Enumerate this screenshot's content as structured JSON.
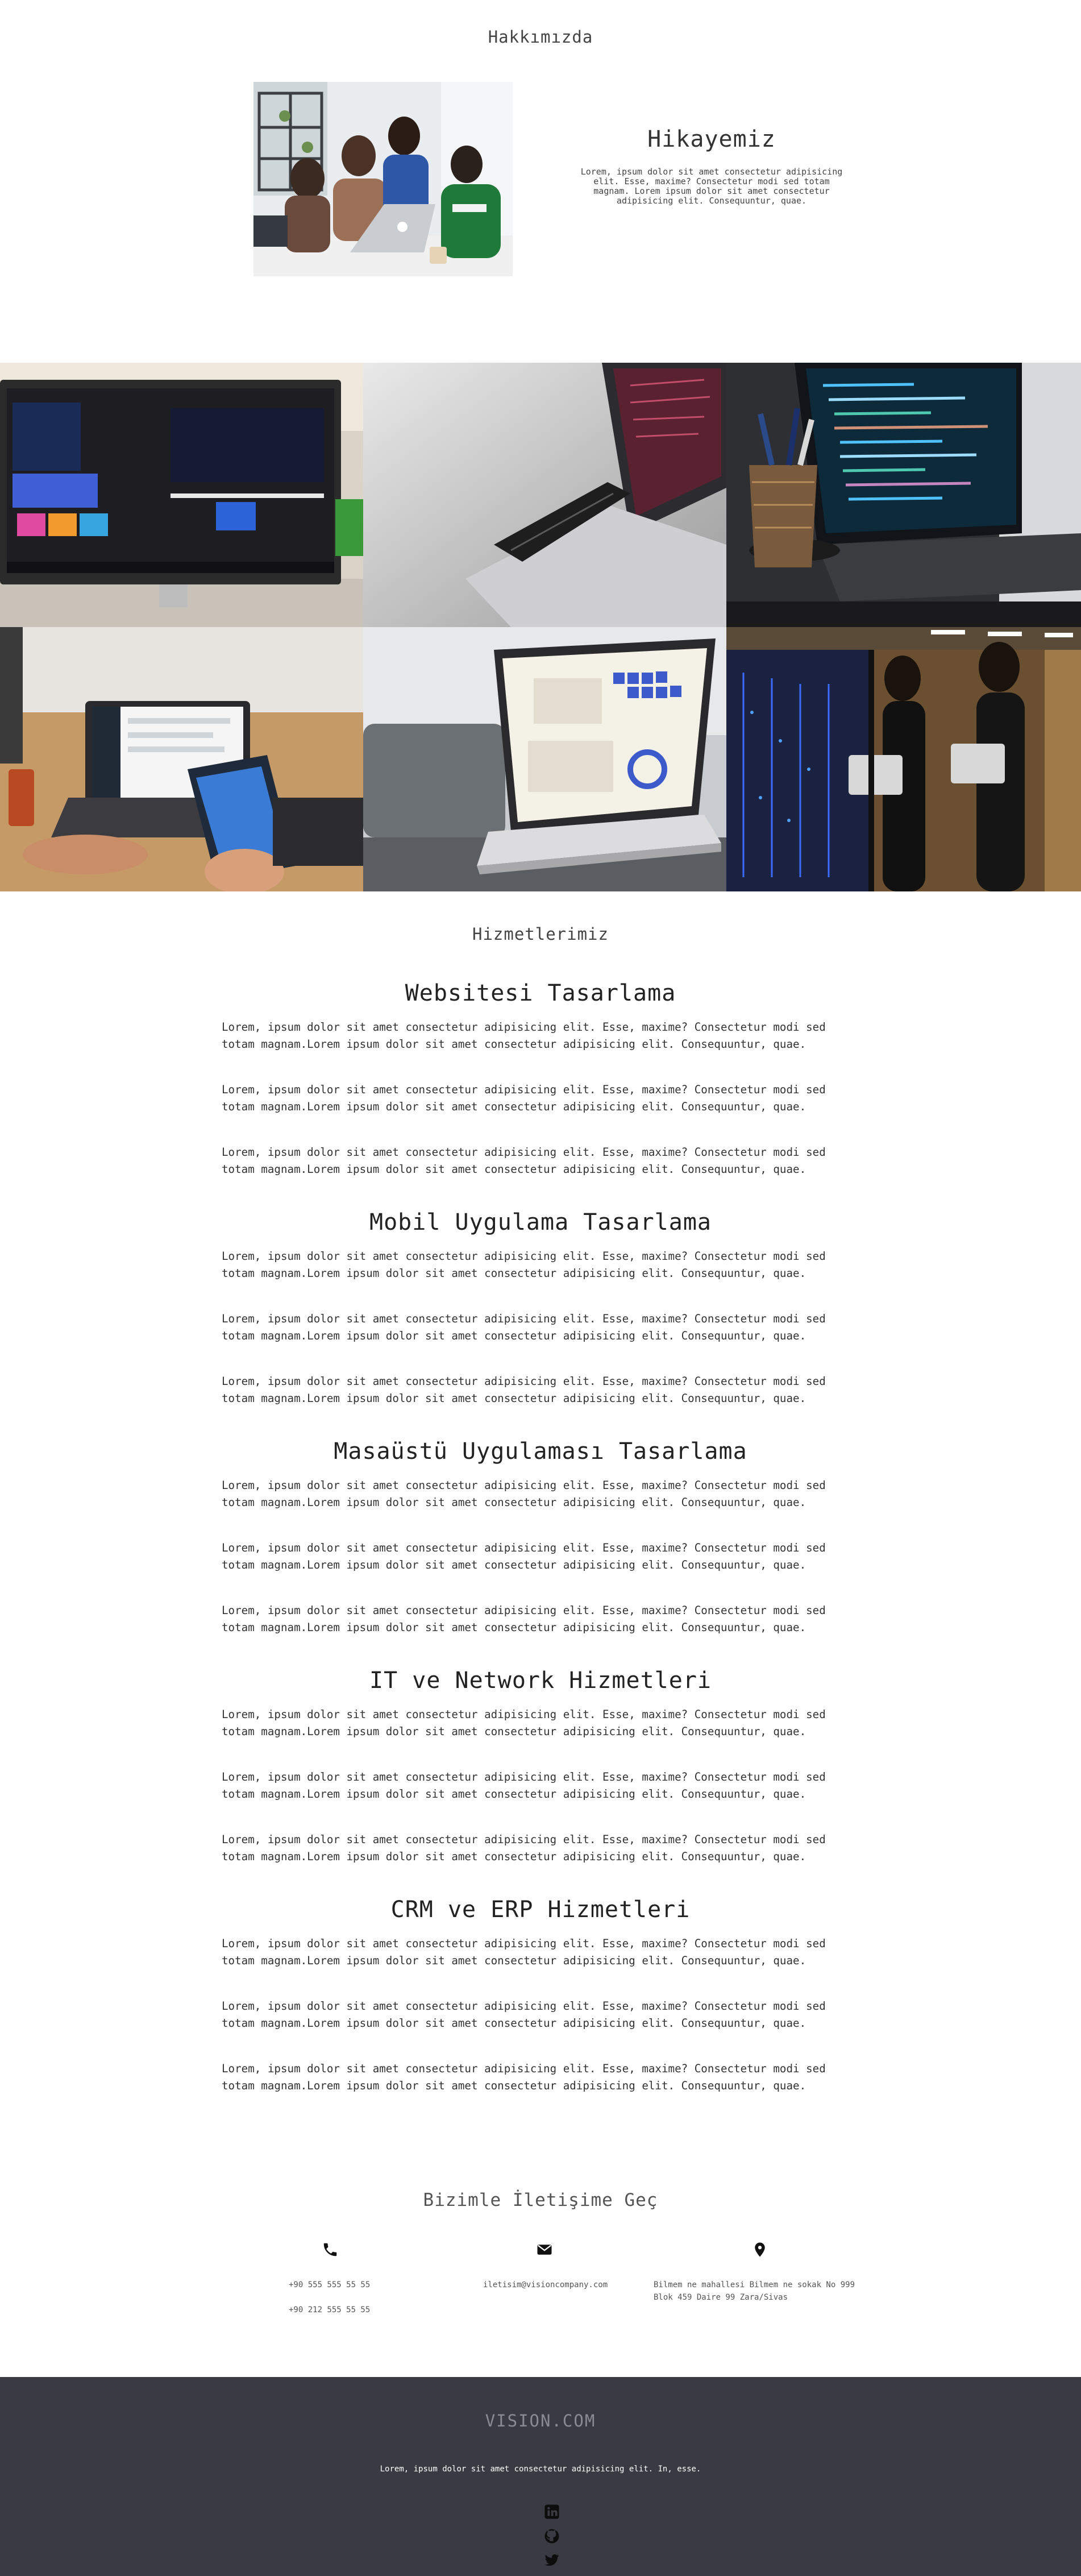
{
  "about": {
    "section_title": "Hakkımızda",
    "story_title": "Hikayemiz",
    "story_text": "Lorem, ipsum dolor sit amet consectetur adipisicing elit. Esse, maxime? Consectetur modi sed totam magnam. Lorem ipsum dolor sit amet consectetur adipisicing elit. Consequuntur, quae.",
    "image": "team-working-photo"
  },
  "gallery": {
    "images": [
      "monitor-photo",
      "laptop-phone-photo",
      "code-laptop-photo",
      "phone-laptop-photo",
      "laptop-dashboard-photo",
      "woman-tablet-photo"
    ]
  },
  "services": {
    "section_title": "Hizmetlerimiz",
    "paragraph": "Lorem, ipsum dolor sit amet consectetur adipisicing elit. Esse, maxime? Consectetur modi sed totam magnam.Lorem ipsum dolor sit amet consectetur adipisicing elit. Consequuntur, quae.",
    "items": [
      {
        "title": "Websitesi Tasarlama"
      },
      {
        "title": "Mobil Uygulama Tasarlama"
      },
      {
        "title": "Masaüstü Uygulaması Tasarlama"
      },
      {
        "title": "IT ve Network Hizmetleri"
      },
      {
        "title": "CRM ve ERP Hizmetleri"
      }
    ]
  },
  "contact": {
    "title": "Bizimle İletişime Geç",
    "phone1": "+90 555 555 55 55",
    "phone2": "+90 212 555 55 55",
    "email": "iletisim@visioncompany.com",
    "address": "Bilmem ne mahallesi Bilmem ne sokak No 999 Blok 459 Daire 99 Zara/Sivas",
    "icons": [
      "phone-icon",
      "envelope-icon",
      "map-marker-icon"
    ]
  },
  "footer": {
    "brand": "VISION.COM",
    "text": "Lorem, ipsum dolor sit amet consectetur adipisicing elit. In, esse.",
    "social": [
      "linkedin-icon",
      "github-icon",
      "twitter-icon"
    ]
  }
}
